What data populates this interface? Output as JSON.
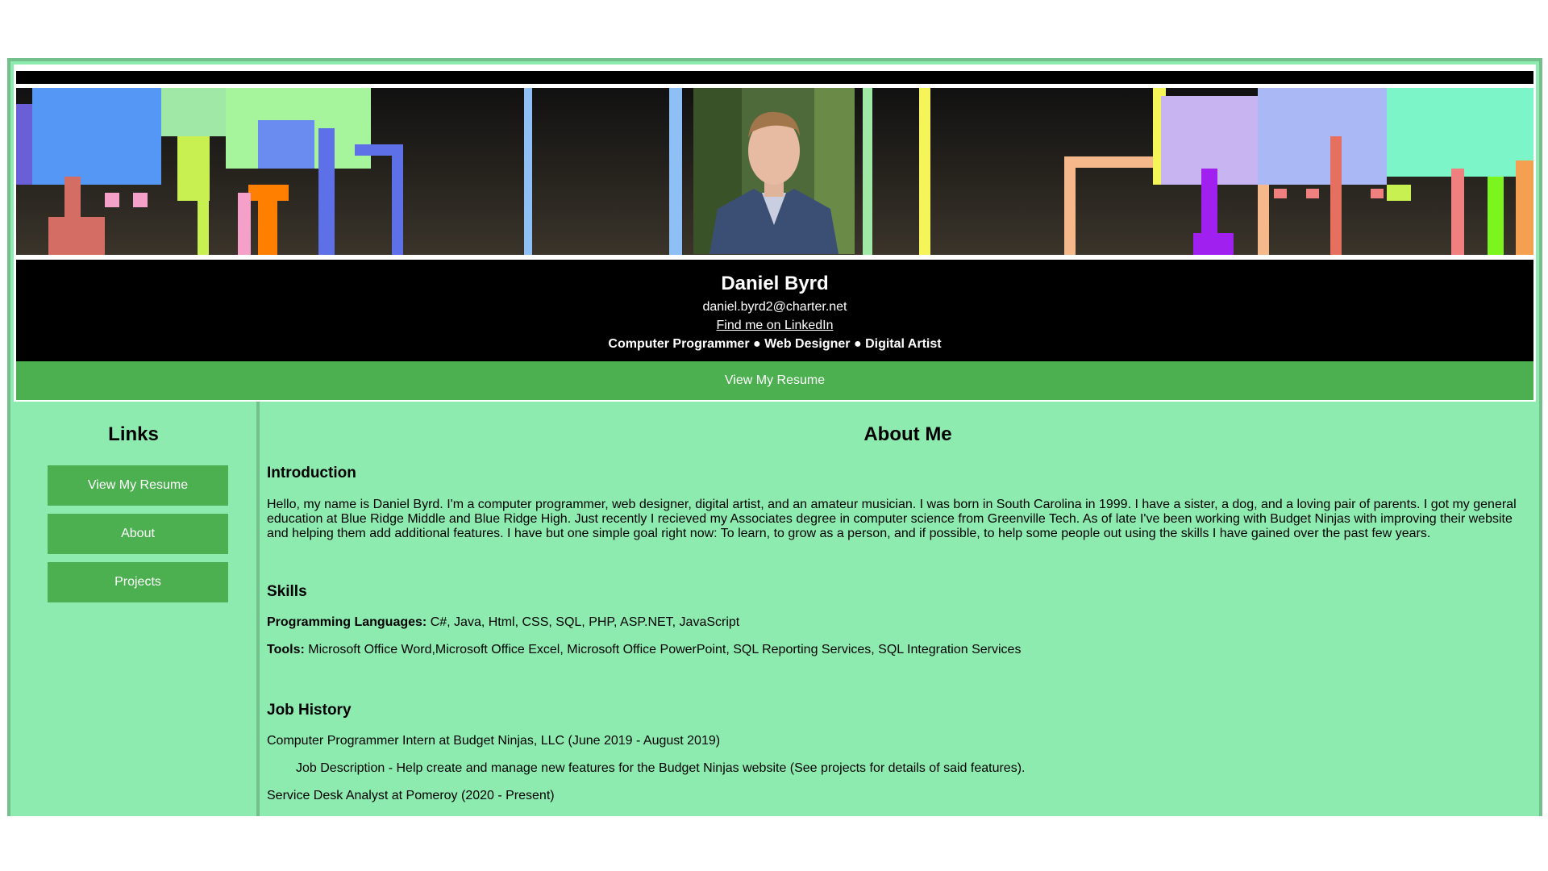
{
  "header": {
    "name": "Daniel Byrd",
    "email": "daniel.byrd2@charter.net",
    "linkedin_label": "Find me on LinkedIn",
    "roles": "Computer Programmer ● Web Designer ● Digital Artist",
    "resume_button": "View My Resume"
  },
  "sidebar": {
    "title": "Links",
    "items": [
      {
        "label": "View My Resume"
      },
      {
        "label": "About"
      },
      {
        "label": "Projects"
      }
    ]
  },
  "main": {
    "title": "About Me",
    "intro": {
      "heading": "Introduction",
      "text": "Hello, my name is Daniel Byrd. I'm a computer programmer, web designer, digital artist, and an amateur musician. I was born in South Carolina in 1999. I have a sister, a dog, and a loving pair of parents. I got my general education at Blue Ridge Middle and Blue Ridge High. Just recently I recieved my Associates degree in computer science from Greenville Tech. As of late I've been working with Budget Ninjas with improving their website and helping them add additional features. I have but one simple goal right now: To learn, to grow as a person, and if possible, to help some people out using the skills I have gained over the past few years."
    },
    "skills": {
      "heading": "Skills",
      "languages_label": "Programming Languages:",
      "languages_value": " C#, Java, Html, CSS, SQL, PHP, ASP.NET, JavaScript",
      "tools_label": "Tools:",
      "tools_value": " Microsoft Office Word,Microsoft Office Excel, Microsoft Office PowerPoint, SQL Reporting Services, SQL Integration Services"
    },
    "jobs": {
      "heading": "Job History",
      "job1": "Computer Programmer Intern at Budget Ninjas, LLC (June 2019 - August 2019)",
      "job1_desc": "Job Description - Help create and manage new features for the Budget Ninjas website (See projects for details of said features).",
      "job2": "Service Desk Analyst at Pomeroy (2020 - Present)"
    }
  },
  "colors": {
    "accent_green": "#4caf50",
    "page_background": "#8debb0",
    "border": "#74c08d"
  }
}
